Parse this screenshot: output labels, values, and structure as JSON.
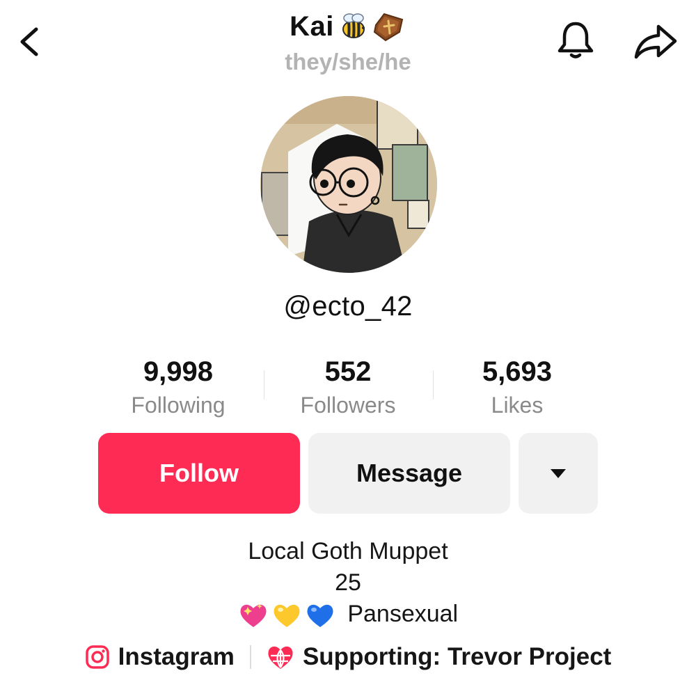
{
  "header": {
    "display_name": "Kai",
    "name_emojis": [
      "bee-emoji",
      "coffin-emoji"
    ],
    "pronouns": "they/she/he",
    "icons": {
      "back": "chevron-left-icon",
      "notifications": "bell-icon",
      "share": "share-arrow-icon"
    }
  },
  "profile": {
    "username": "@ecto_42"
  },
  "stats": [
    {
      "value": "9,998",
      "label": "Following"
    },
    {
      "value": "552",
      "label": "Followers"
    },
    {
      "value": "5,693",
      "label": "Likes"
    }
  ],
  "actions": {
    "follow_label": "Follow",
    "message_label": "Message",
    "more_icon": "caret-down-icon"
  },
  "bio": {
    "line1": "Local Goth Muppet",
    "line2": "25",
    "line3_emojis": [
      "sparkling-heart-emoji",
      "yellow-heart-emoji",
      "blue-heart-emoji"
    ],
    "line3_text": "Pansexual"
  },
  "links": [
    {
      "label": "Instagram",
      "icon": "instagram-icon"
    },
    {
      "label": "Supporting: Trevor Project",
      "icon": "globe-heart-icon"
    }
  ],
  "colors": {
    "follow_button": "#fe2c55",
    "secondary_button": "#f1f1f2",
    "muted_text": "#8a8a8a",
    "link_icon": "#fe2c55"
  }
}
